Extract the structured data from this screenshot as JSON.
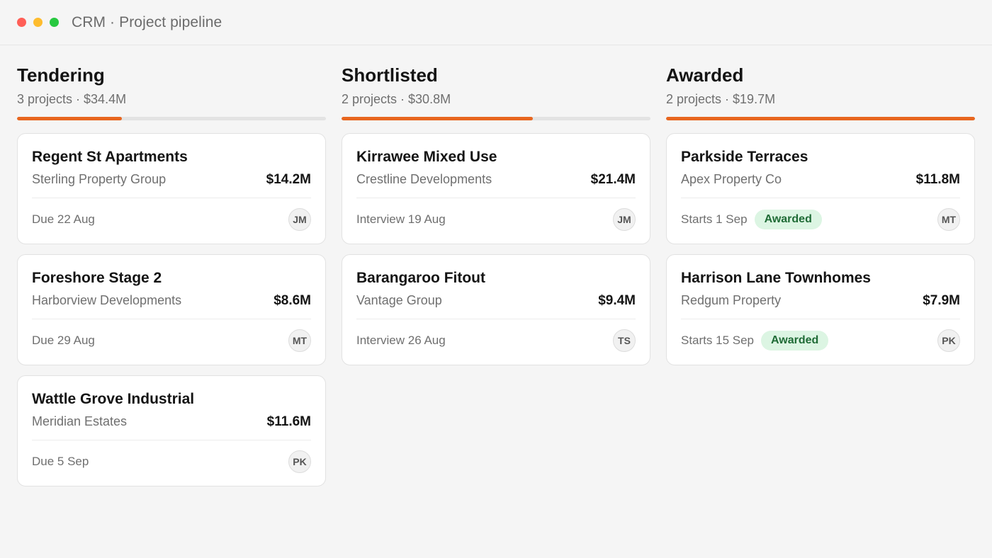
{
  "window": {
    "title": "CRM · Project pipeline"
  },
  "colors": {
    "accent": "#e8661f",
    "track": "#e3e3e3",
    "badge_bg": "#dcf5e3",
    "badge_text": "#1f6b36"
  },
  "columns": [
    {
      "title": "Tendering",
      "summary": "3 projects · $34.4M",
      "progress": 0.34,
      "cards": [
        {
          "title": "Regent St Apartments",
          "client": "Sterling Property Group",
          "amount": "$14.2M",
          "date": "Due 22 Aug",
          "badge": "",
          "assignee": "JM"
        },
        {
          "title": "Foreshore Stage 2",
          "client": "Harborview Developments",
          "amount": "$8.6M",
          "date": "Due 29 Aug",
          "badge": "",
          "assignee": "MT"
        },
        {
          "title": "Wattle Grove Industrial",
          "client": "Meridian Estates",
          "amount": "$11.6M",
          "date": "Due 5 Sep",
          "badge": "",
          "assignee": "PK"
        }
      ]
    },
    {
      "title": "Shortlisted",
      "summary": "2 projects · $30.8M",
      "progress": 0.62,
      "cards": [
        {
          "title": "Kirrawee Mixed Use",
          "client": "Crestline Developments",
          "amount": "$21.4M",
          "date": "Interview 19 Aug",
          "badge": "",
          "assignee": "JM"
        },
        {
          "title": "Barangaroo Fitout",
          "client": "Vantage Group",
          "amount": "$9.4M",
          "date": "Interview 26 Aug",
          "badge": "",
          "assignee": "TS"
        }
      ]
    },
    {
      "title": "Awarded",
      "summary": "2 projects · $19.7M",
      "progress": 1.0,
      "cards": [
        {
          "title": "Parkside Terraces",
          "client": "Apex Property Co",
          "amount": "$11.8M",
          "date": "Starts 1 Sep",
          "badge": "Awarded",
          "assignee": "MT"
        },
        {
          "title": "Harrison Lane Townhomes",
          "client": "Redgum Property",
          "amount": "$7.9M",
          "date": "Starts 15 Sep",
          "badge": "Awarded",
          "assignee": "PK"
        }
      ]
    }
  ]
}
